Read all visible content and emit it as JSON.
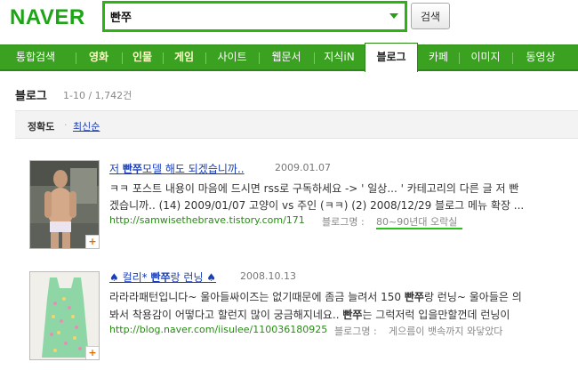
{
  "logo": "NAVER",
  "search": {
    "value": "빤쭈",
    "button_label": "검색"
  },
  "tabs": [
    {
      "label": "통합검색",
      "style": "normal"
    },
    {
      "label": "영화",
      "style": "bold"
    },
    {
      "label": "인물",
      "style": "bold"
    },
    {
      "label": "게임",
      "style": "bold"
    },
    {
      "label": "사이트",
      "style": "normal"
    },
    {
      "label": "웹문서",
      "style": "normal"
    },
    {
      "label": "지식iN",
      "style": "normal"
    },
    {
      "label": "블로그",
      "style": "active"
    },
    {
      "label": "카페",
      "style": "normal"
    },
    {
      "label": "이미지",
      "style": "normal"
    },
    {
      "label": "동영상",
      "style": "normal"
    }
  ],
  "section": {
    "title": "블로그",
    "count": "1-10 / 1,742건"
  },
  "sort": {
    "accuracy": "정확도",
    "separator": "·",
    "recent": "최신순"
  },
  "results": [
    {
      "title_pre": "저 ",
      "title_kw": "빤쭈",
      "title_post": "모델 해도 되겠습니까..",
      "date": "2009.01.07",
      "desc1": "ㅋㅋ 포스트 내용이 마음에 드시면 rss로 구독하세요 -> ' 일상... ' 카테고리의 다른 글 저 빤",
      "desc2": "겠습니까.. (14) 2009/01/07 고양이 vs 주인 (ㅋㅋ) (2) 2008/12/29 블로그 메뉴 확장 ...",
      "url": "http://samwisethebrave.tistory.com/171",
      "blog_label": "블로그명 :",
      "blog_name": "80~90년대 오락실"
    },
    {
      "title_pre": "♠ 컬리* ",
      "title_kw": "빤쭈",
      "title_post": "랑 런닝 ♠",
      "date": "2008.10.13",
      "desc1_pre": "라라라패턴입니다~ 울아들싸이즈는 없기때문에 좀금 늘려서 150 ",
      "desc1_kw": "빤쭈",
      "desc1_post": "랑 런닝~ 울아들은 의",
      "desc2_pre": "봐서 착용감이 어떻다고 할런지 많이 궁금해지네요.. ",
      "desc2_kw": "빤쭈",
      "desc2_post": "는 그럭저럭 입을만할껀데 런닝이",
      "url": "http://blog.naver.com/iisulee/110036180925",
      "blog_label": "블로그명 :",
      "blog_name": "게으름이 뱃속까지 와닿았다"
    }
  ],
  "plus_glyph": "+"
}
